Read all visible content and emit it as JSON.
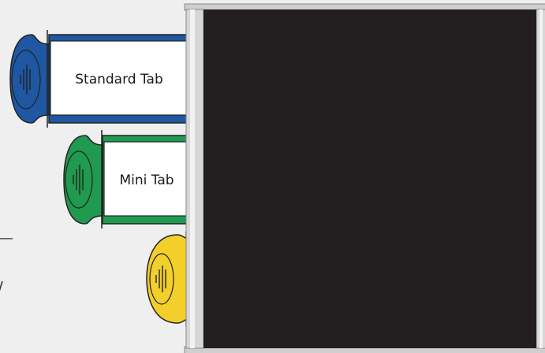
{
  "tabs": [
    {
      "label": "Standard Tab",
      "color": "#1f57a2"
    },
    {
      "label": "Mini Tab",
      "color": "#1f9a4f"
    },
    {
      "label": "",
      "color": "#f2cf2b"
    }
  ],
  "margin_marks": [
    "—",
    "/"
  ],
  "colors": {
    "background": "#efefef",
    "screen": "#231f20",
    "frame": "#d7d7d7",
    "outline": "#222222"
  }
}
